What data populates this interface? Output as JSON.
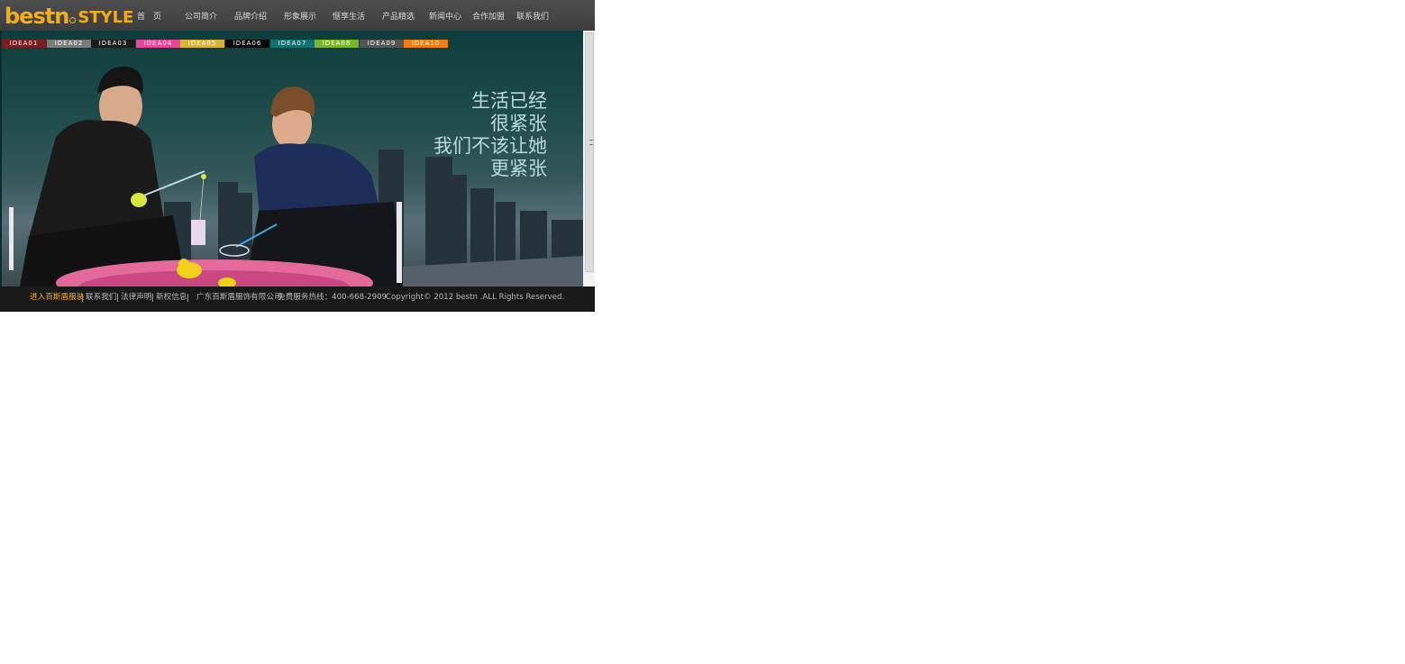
{
  "header": {
    "logo": {
      "part1": "bestn",
      "part2": "STYLE"
    },
    "nav": [
      {
        "id": "home",
        "label": "首　页"
      },
      {
        "id": "company",
        "label": "公司简介"
      },
      {
        "id": "brand",
        "label": "品牌介绍"
      },
      {
        "id": "image",
        "label": "形象展示"
      },
      {
        "id": "lifestyle",
        "label": "惬享生活"
      },
      {
        "id": "products",
        "label": "产品精选"
      },
      {
        "id": "news",
        "label": "新闻中心"
      },
      {
        "id": "join",
        "label": "合作加盟"
      },
      {
        "id": "contact",
        "label": "联系我们"
      }
    ]
  },
  "banner": {
    "tabs": [
      {
        "label": "IDEA01",
        "color": "#7a1d22"
      },
      {
        "label": "IDEA02",
        "color": "#7b7b7b"
      },
      {
        "label": "IDEA03",
        "color": "#1a1a1a"
      },
      {
        "label": "IDEA04",
        "color": "#e8469a"
      },
      {
        "label": "IDEA05",
        "color": "#d9b23c"
      },
      {
        "label": "IDEA06",
        "color": "#050505"
      },
      {
        "label": "IDEA07",
        "color": "#12706e"
      },
      {
        "label": "IDEA08",
        "color": "#7ab52a"
      },
      {
        "label": "IDEA09",
        "color": "#555555"
      },
      {
        "label": "IDEA10",
        "color": "#f07d12"
      }
    ],
    "slogan": [
      "生活已经",
      "很紧张",
      "我们不该让她",
      "更紧张"
    ],
    "scrollbar_grip_icon": "grip-icon"
  },
  "footer": {
    "enter": "进入百斯盾服装",
    "links": [
      "联系我们",
      "法律声明",
      "新权信息"
    ],
    "company": "广东百斯盾服饰有限公司",
    "hotline": "免费服务热线：400-668-2909",
    "copyright": "Copyright©  2012  bestn  .ALL Rights Reserved."
  },
  "colors": {
    "accent": "#f3ad1a",
    "header_bg": "#474747",
    "footer_bg": "#191919"
  }
}
